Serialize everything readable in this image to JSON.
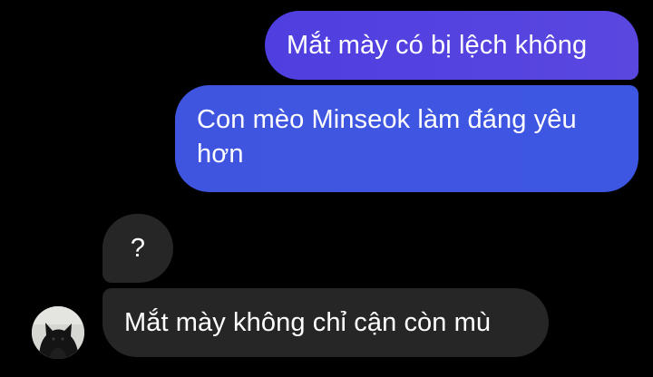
{
  "messages": [
    {
      "sender": "me",
      "text": "Mắt mày có bị lệch không"
    },
    {
      "sender": "me",
      "text": "Con mèo Minseok làm đáng yêu hơn"
    },
    {
      "sender": "other",
      "text": "?"
    },
    {
      "sender": "other",
      "text": "Mắt mày không chỉ cận còn mù"
    }
  ],
  "avatar": {
    "icon": "black-cat-avatar-icon"
  },
  "colors": {
    "background": "#000000",
    "outgoing_bubble_top": "#5a47e0",
    "outgoing_bubble_bottom": "#3e57e2",
    "incoming_bubble": "#262626",
    "text": "#ffffff"
  }
}
